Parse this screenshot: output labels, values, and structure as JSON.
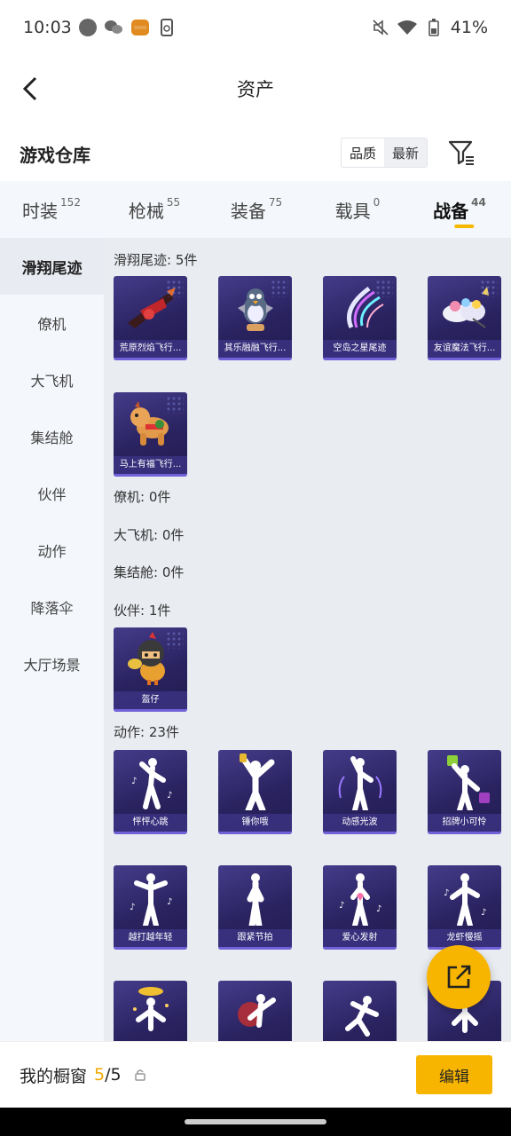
{
  "status_bar": {
    "time": "10:03",
    "battery": "41%"
  },
  "header": {
    "title": "资产"
  },
  "warehouse": {
    "title": "游戏仓库",
    "sort_quality": "品质",
    "sort_latest": "最新"
  },
  "tabs": [
    {
      "label": "时装",
      "count": "152"
    },
    {
      "label": "枪械",
      "count": "55"
    },
    {
      "label": "装备",
      "count": "75"
    },
    {
      "label": "载具",
      "count": "0"
    },
    {
      "label": "战备",
      "count": "44",
      "active": true
    }
  ],
  "sidebar": [
    "滑翔尾迹",
    "僚机",
    "大飞机",
    "集结舱",
    "伙伴",
    "动作",
    "降落伞",
    "大厅场景"
  ],
  "sections": {
    "glide": "滑翔尾迹: 5件",
    "wingman": "僚机: 0件",
    "plane": "大飞机: 0件",
    "pod": "集结舱: 0件",
    "companion": "伙伴: 1件",
    "emote": "动作: 23件"
  },
  "glide_items": [
    "荒原烈焰飞行...",
    "其乐融融飞行...",
    "空岛之星尾迹",
    "友谊魔法飞行...",
    "马上有福飞行..."
  ],
  "companion_items": [
    "盔仔"
  ],
  "emote_items": [
    "怦怦心跳",
    "锤你哦",
    "动感光波",
    "招牌小可怜",
    "越打越年轻",
    "跟紧节拍",
    "爱心发射",
    "龙虾慢摇"
  ],
  "bottom": {
    "label": "我的橱窗",
    "current": "5",
    "total": "/5",
    "edit": "编辑"
  },
  "colors": {
    "accent": "#f7b500",
    "card": "#2a2360"
  }
}
